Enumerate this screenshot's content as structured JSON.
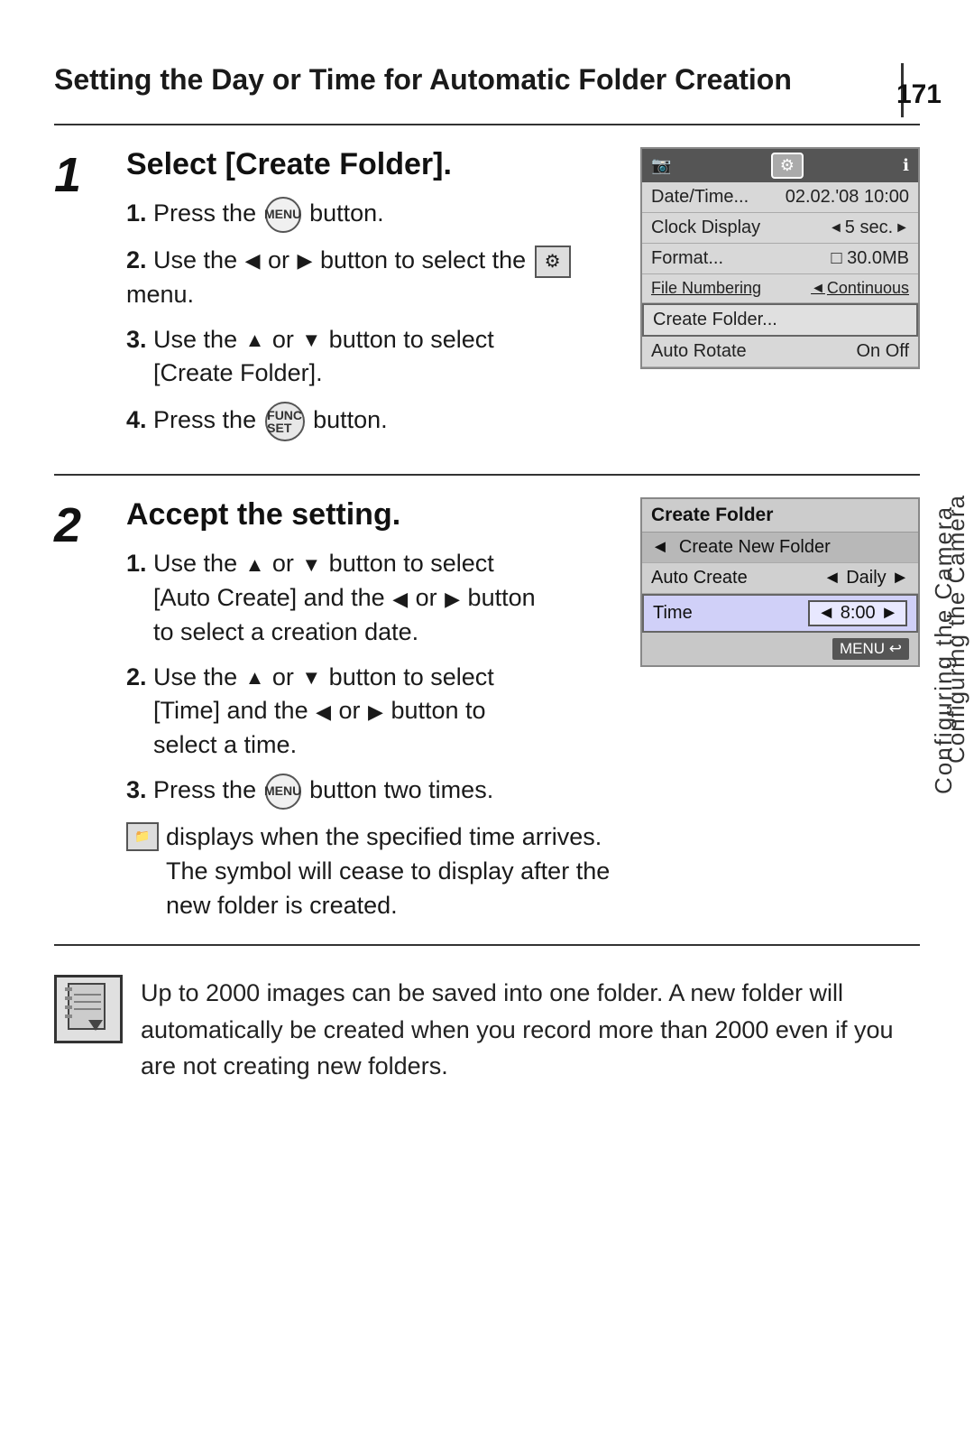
{
  "page": {
    "number": "171",
    "title": "Setting the Day or Time for Automatic Folder Creation"
  },
  "sidebar": {
    "label": "Configuring the Camera"
  },
  "section1": {
    "number": "1",
    "title": "Select [Create Folder].",
    "steps": [
      {
        "num": "1.",
        "text": "Press the",
        "button": "MENU",
        "text2": "button."
      },
      {
        "num": "2.",
        "text": "Use the",
        "arrow_left": "◄",
        "or": "or",
        "arrow_right": "►",
        "text2": "button to select the",
        "menu_icon": "⚙",
        "text3": "menu."
      },
      {
        "num": "3.",
        "text": "Use the",
        "arrow_up": "▲",
        "or": "or",
        "arrow_down": "▼",
        "text2": "button to select [Create Folder]."
      },
      {
        "num": "4.",
        "text": "Press the",
        "button": "FUNC SET",
        "text2": "button."
      }
    ]
  },
  "section1_screenshot": {
    "header": {
      "camera_icon": "📷",
      "selected_icon": "⚙",
      "info_icon": "ℹ"
    },
    "rows": [
      {
        "label": "Date/Time...",
        "value": "02.02.'08 10:00",
        "highlighted": false
      },
      {
        "label": "Clock Display",
        "value": "◄ 5 sec.",
        "arrow_right": "►",
        "highlighted": false
      },
      {
        "label": "Format...",
        "value": "□  30.0MB",
        "highlighted": false
      },
      {
        "label": "File Numbering",
        "value": "◄ Continuous",
        "highlighted": false
      },
      {
        "label": "Create Folder...",
        "value": "",
        "highlighted": true
      },
      {
        "label": "Auto Rotate",
        "value": "On  Off",
        "highlighted": false
      }
    ]
  },
  "section2": {
    "number": "2",
    "title": "Accept the setting.",
    "steps": [
      {
        "num": "1.",
        "text": "Use the",
        "arrow_up": "▲",
        "or1": "or",
        "arrow_down": "▼",
        "text2": "button to select [Auto Create] and the",
        "arrow_left": "◄",
        "or2": "or",
        "arrow_right": "►",
        "text3": "button to select a creation date."
      },
      {
        "num": "2.",
        "text": "Use the",
        "arrow_up": "▲",
        "or1": "or",
        "arrow_down": "▼",
        "text2": "button to select [Time] and the",
        "arrow_left": "◄",
        "or2": "or",
        "arrow_right": "►",
        "text3": "button to select a time."
      },
      {
        "num": "3.",
        "text": "Press the",
        "button": "MENU",
        "text2": "button two times."
      }
    ],
    "bullet_text": "displays when the specified time arrives. The symbol will cease to display after the new folder is created."
  },
  "section2_screenshot": {
    "title": "Create Folder",
    "rows": [
      {
        "type": "create-new",
        "label": "◄  Create New Folder",
        "value": ""
      },
      {
        "type": "auto-create",
        "label": "Auto Create",
        "value": "◄ Daily ►"
      },
      {
        "type": "time-row",
        "label": "Time",
        "value": "◄ 8:00 ►"
      }
    ],
    "footer": "MENU ↩"
  },
  "note": {
    "icon": "≡\n▲",
    "text": "Up to 2000 images can be saved into one folder. A new folder will automatically be created when you record more than 2000 even if you are not creating new folders."
  }
}
